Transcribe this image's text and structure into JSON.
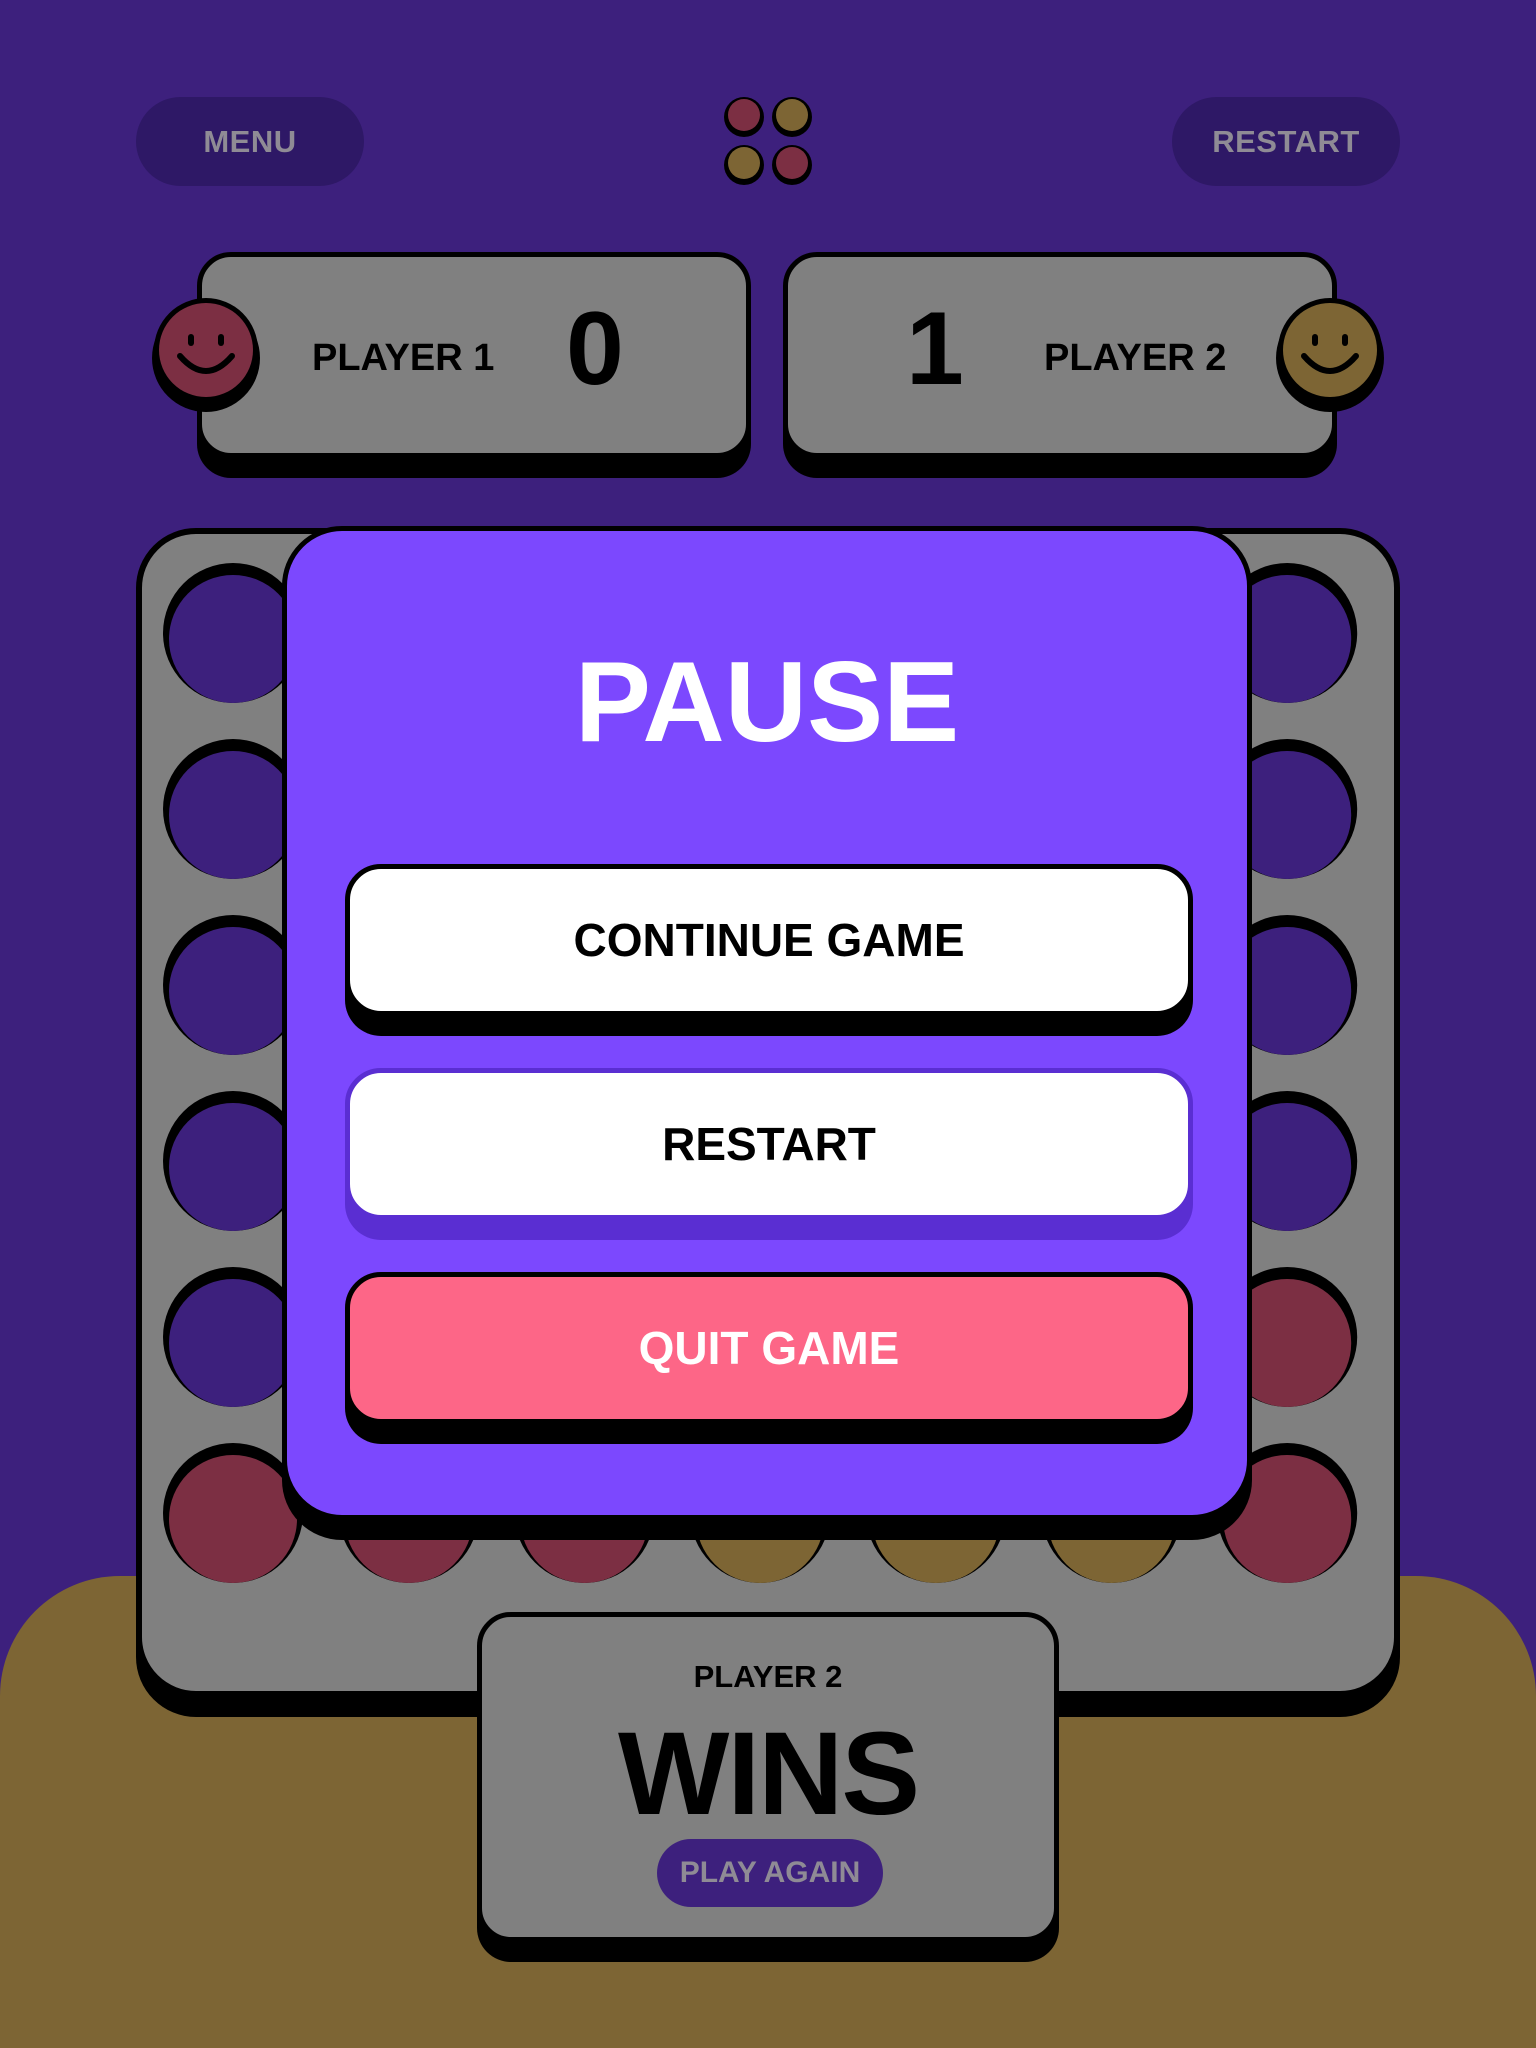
{
  "header": {
    "menu_label": "MENU",
    "restart_label": "RESTART"
  },
  "scores": {
    "player1": {
      "label": "PLAYER 1",
      "score": "0",
      "color": "#fd6687"
    },
    "player2": {
      "label": "PLAYER 2",
      "score": "1",
      "color": "#ffce67"
    }
  },
  "board": {
    "columns": 7,
    "rows": 6,
    "grid": [
      [
        "empty",
        "empty",
        "empty",
        "empty",
        "empty",
        "empty",
        "empty"
      ],
      [
        "empty",
        "empty",
        "empty",
        "empty",
        "empty",
        "empty",
        "empty"
      ],
      [
        "empty",
        "empty",
        "empty",
        "empty",
        "empty",
        "empty",
        "empty"
      ],
      [
        "empty",
        "empty",
        "empty",
        "empty",
        "empty",
        "empty",
        "empty"
      ],
      [
        "empty",
        "empty",
        "empty",
        "empty",
        "empty",
        "empty",
        "red"
      ],
      [
        "red",
        "red",
        "red",
        "yellow",
        "yellow",
        "yellow",
        "red"
      ]
    ],
    "colors": {
      "red": "#7c2f43",
      "yellow": "#7d6534",
      "empty": "#3d207d"
    }
  },
  "result": {
    "player_label": "PLAYER 2",
    "title": "WINS",
    "play_again_label": "PLAY AGAIN"
  },
  "pause_menu": {
    "title": "PAUSE",
    "continue_label": "CONTINUE GAME",
    "restart_label": "RESTART",
    "quit_label": "QUIT GAME"
  },
  "colors": {
    "background": "#3d207d",
    "modal": "#7c48fe",
    "quit": "#fd6687",
    "bottom": "#7d6534"
  }
}
